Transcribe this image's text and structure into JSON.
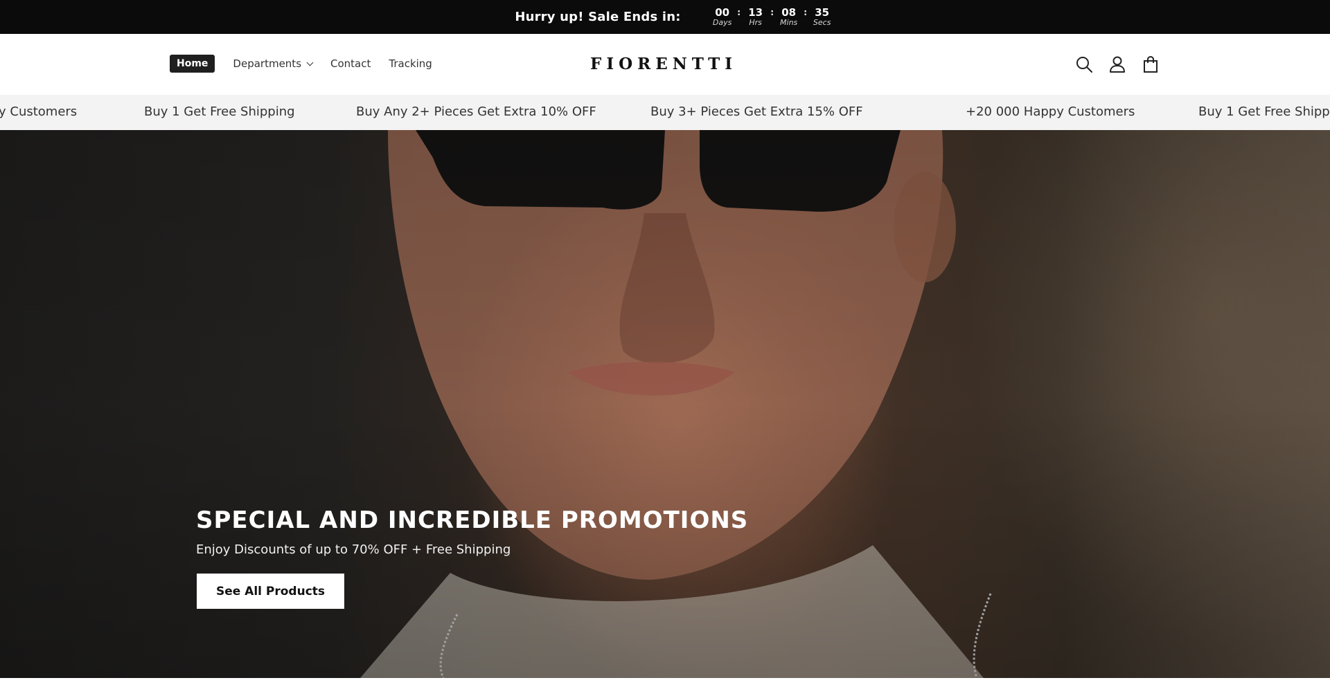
{
  "announcement": {
    "text": "Hurry up! Sale Ends in:",
    "countdown": [
      {
        "value": "00",
        "label": "Days"
      },
      {
        "value": "13",
        "label": "Hrs"
      },
      {
        "value": "08",
        "label": "Mins"
      },
      {
        "value": "35",
        "label": "Secs"
      }
    ],
    "separator": ":"
  },
  "header": {
    "nav": [
      {
        "label": "Home",
        "active": true
      },
      {
        "label": "Departments",
        "has_dropdown": true
      },
      {
        "label": "Contact"
      },
      {
        "label": "Tracking"
      }
    ],
    "logo": "FIORENTTI",
    "icons": [
      "search-icon",
      "account-icon",
      "cart-icon"
    ]
  },
  "marquee": {
    "items": [
      "y Customers",
      "Buy 1 Get Free Shipping",
      "Buy Any 2+ Pieces Get Extra 10% OFF",
      "Buy 3+ Pieces Get Extra 15% OFF",
      "+20 000 Happy Customers",
      "Buy 1 Get Free Shippin"
    ]
  },
  "hero": {
    "title": "SPECIAL AND INCREDIBLE PROMOTIONS",
    "subtitle": "Enjoy Discounts of up to 70% OFF + Free Shipping",
    "cta": "See All Products"
  },
  "colors": {
    "topbar_bg": "#0b0b0b",
    "marquee_bg": "#f3f3f3",
    "nav_active_bg": "#1f1f1f",
    "button_bg": "#ffffff"
  }
}
